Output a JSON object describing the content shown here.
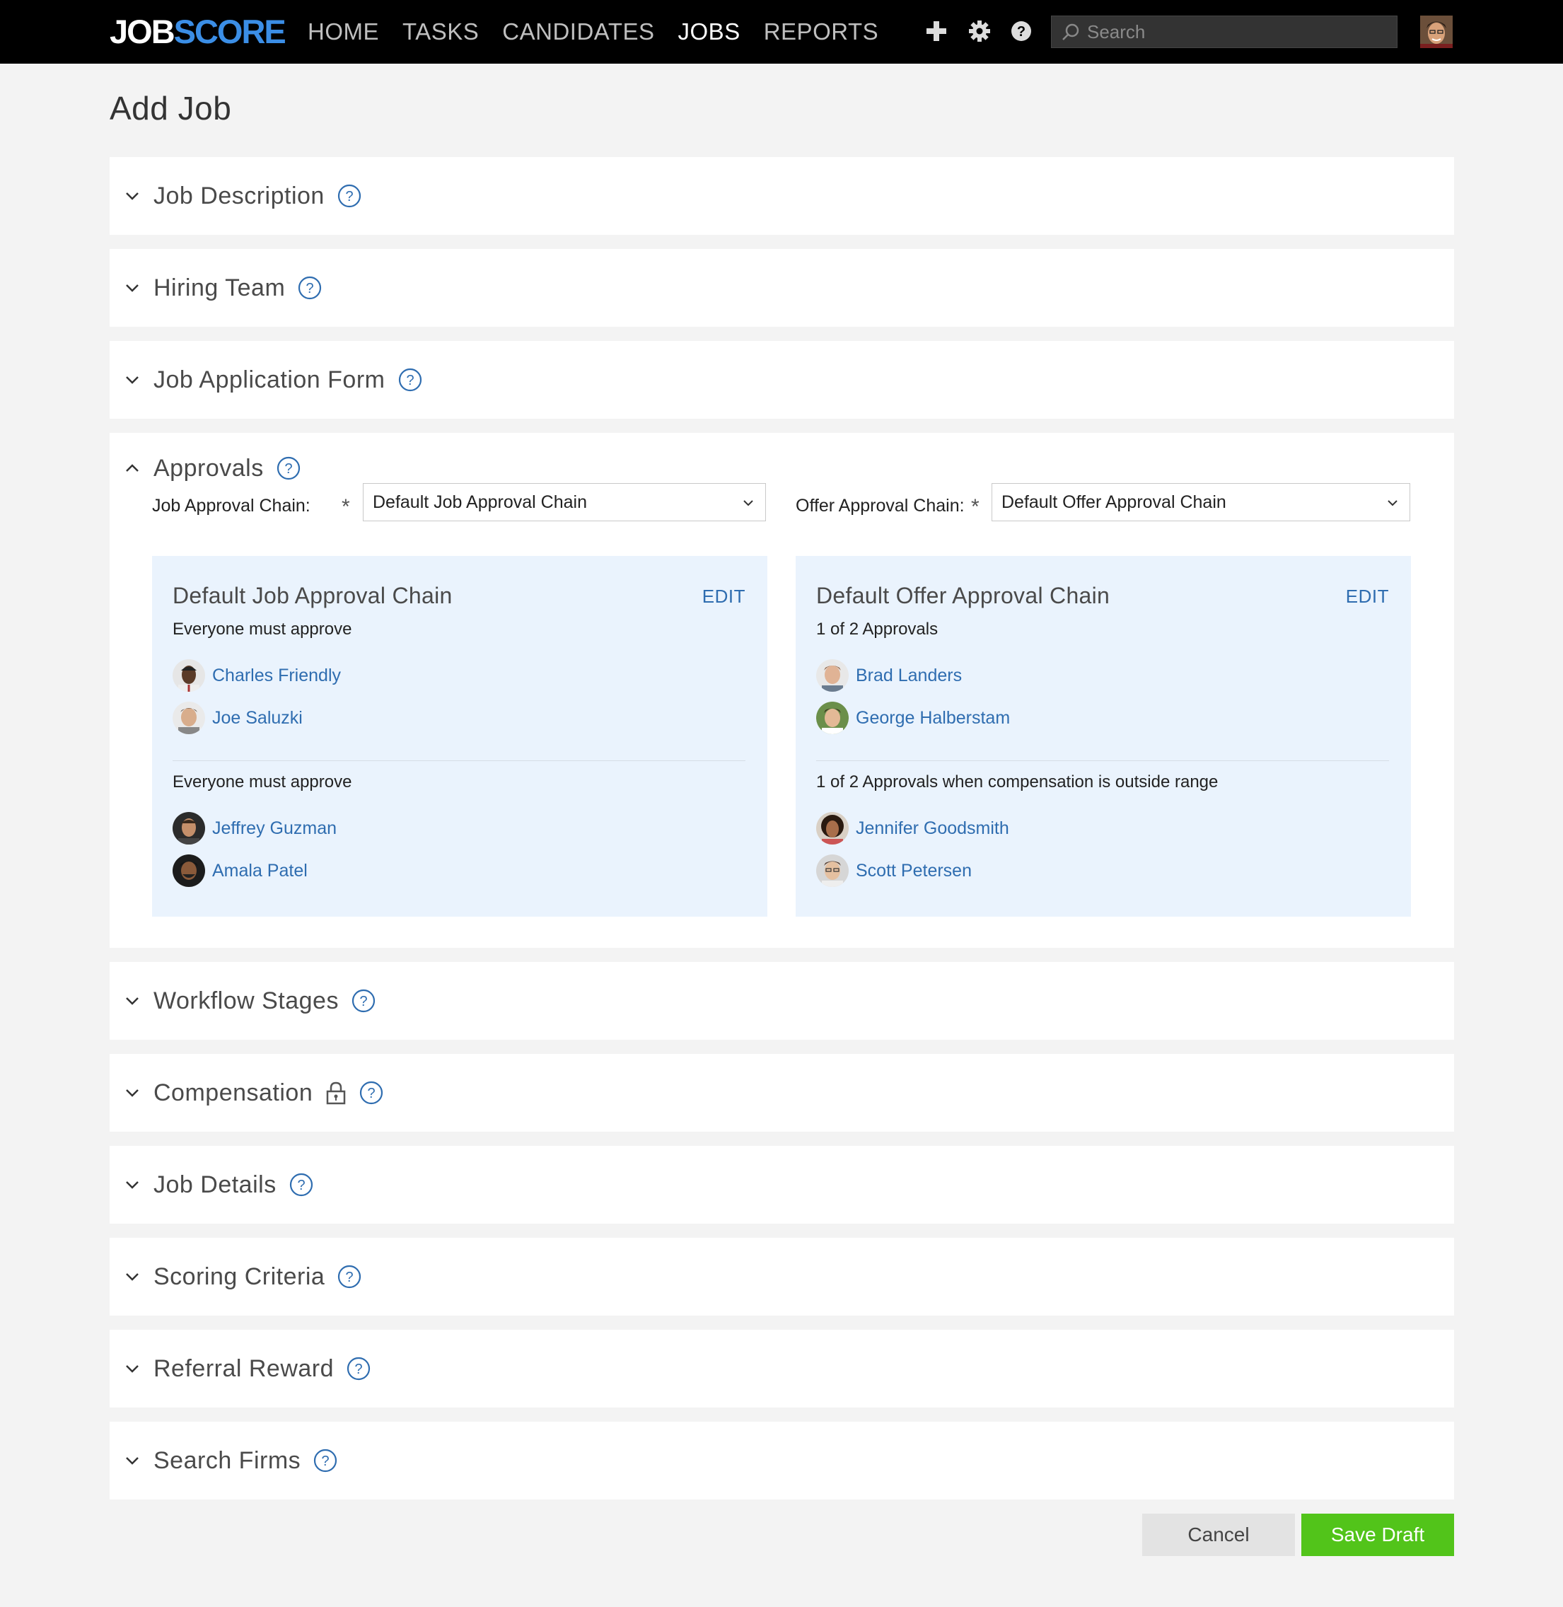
{
  "header": {
    "logo_part1": "JOB",
    "logo_part2": "SCORE",
    "nav": [
      {
        "label": "HOME"
      },
      {
        "label": "TASKS"
      },
      {
        "label": "CANDIDATES"
      },
      {
        "label": "JOBS",
        "active": true
      },
      {
        "label": "REPORTS"
      }
    ],
    "search_placeholder": "Search",
    "icons": [
      "plus-icon",
      "gear-icon",
      "help-icon",
      "search-icon"
    ]
  },
  "page": {
    "title": "Add Job"
  },
  "sections": {
    "job_description": "Job Description",
    "hiring_team": "Hiring Team",
    "job_application_form": "Job Application Form",
    "approvals": "Approvals",
    "workflow_stages": "Workflow Stages",
    "compensation": "Compensation",
    "job_details": "Job Details",
    "scoring_criteria": "Scoring Criteria",
    "referral_reward": "Referral Reward",
    "search_firms": "Search Firms"
  },
  "approvals": {
    "job_chain_label": "Job Approval Chain:",
    "job_chain_value": "Default Job Approval Chain",
    "offer_chain_label": "Offer Approval Chain:",
    "offer_chain_value": "Default Offer Approval Chain",
    "required_mark": "*",
    "job_card": {
      "title": "Default Job Approval Chain",
      "edit": "EDIT",
      "group1_rule": "Everyone must approve",
      "group1_people": [
        "Charles Friendly",
        "Joe Saluzki"
      ],
      "group2_rule": "Everyone must approve",
      "group2_people": [
        "Jeffrey Guzman",
        "Amala Patel"
      ]
    },
    "offer_card": {
      "title": "Default Offer Approval Chain",
      "edit": "EDIT",
      "group1_rule": "1 of 2 Approvals",
      "group1_people": [
        "Brad Landers",
        "George Halberstam"
      ],
      "group2_rule": "1 of 2 Approvals when compensation is outside range",
      "group2_people": [
        "Jennifer Goodsmith",
        "Scott Petersen"
      ]
    }
  },
  "buttons": {
    "cancel": "Cancel",
    "save_draft": "Save Draft"
  },
  "colors": {
    "topbar": "#000000",
    "accent_link": "#2f6db0",
    "card_bg": "#eaf3fd",
    "save_button": "#52c41a",
    "page_bg": "#f3f3f3"
  }
}
